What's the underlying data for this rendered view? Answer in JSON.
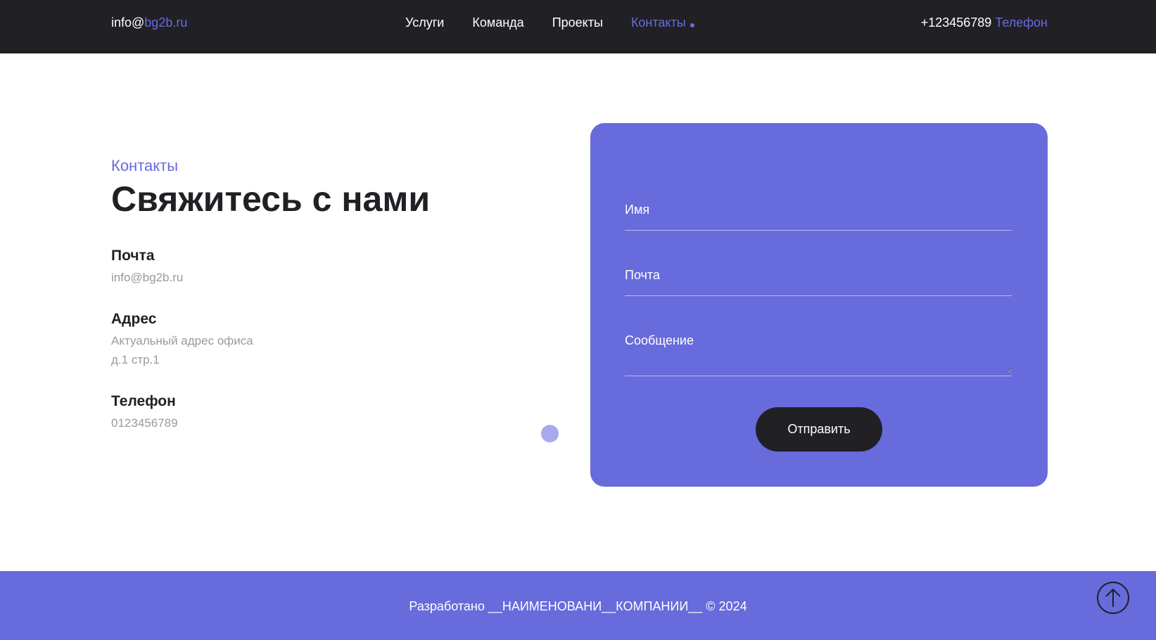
{
  "header": {
    "email_prefix": "info@",
    "email_domain": "bg2b.ru",
    "nav": [
      {
        "label": "Услуги"
      },
      {
        "label": "Команда"
      },
      {
        "label": "Проекты"
      },
      {
        "label": "Контакты"
      }
    ],
    "phone_number": "+123456789",
    "phone_label": "Телефон"
  },
  "contacts": {
    "eyebrow": "Контакты",
    "heading": "Свяжитесь с нами",
    "email_title": "Почта",
    "email_value": "info@bg2b.ru",
    "address_title": "Адрес",
    "address_line1": "Актуальный адрес офиса",
    "address_line2": "д.1 стр.1",
    "phone_title": "Телефон",
    "phone_value": "0123456789"
  },
  "form": {
    "name_placeholder": "Имя",
    "email_placeholder": "Почта",
    "message_placeholder": "Сообщение",
    "submit_label": "Отправить"
  },
  "footer": {
    "text": "Разработано __НАИМЕНОВАНИ__КОМПАНИИ__ © 2024"
  },
  "colors": {
    "accent": "#676bdb",
    "dark": "#212025"
  },
  "icons": {
    "scroll_top": "arrow-up-icon",
    "active_marker": "dot-icon",
    "decor": "circle-decor"
  }
}
